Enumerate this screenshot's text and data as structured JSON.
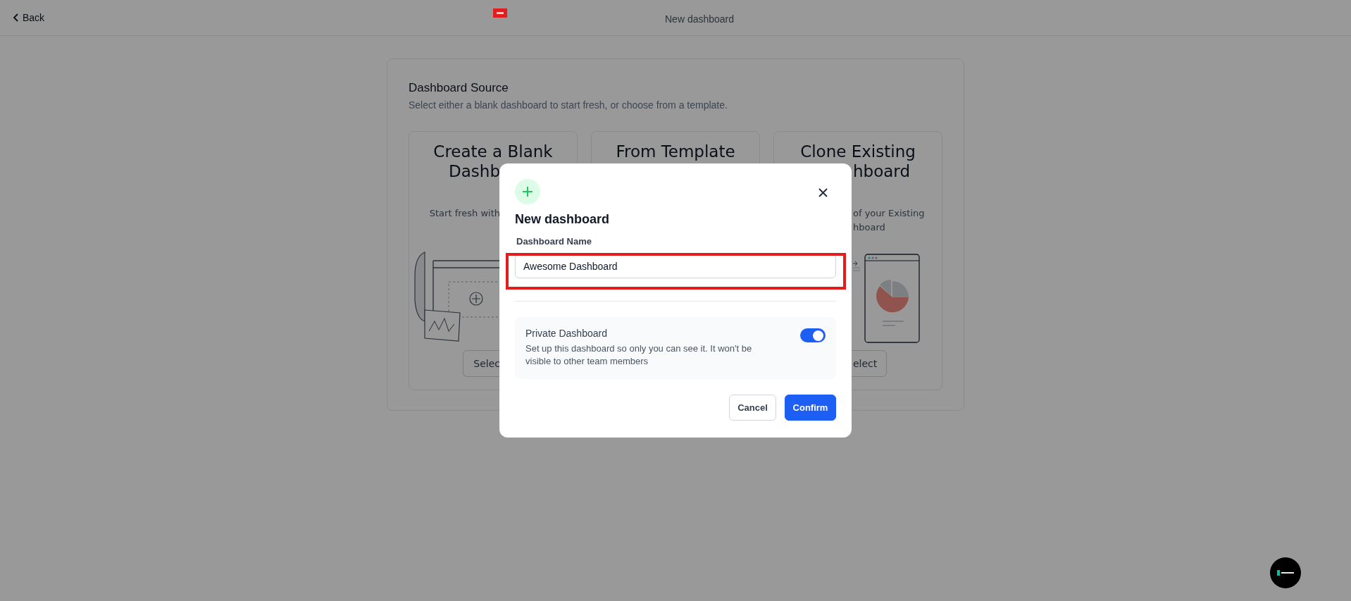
{
  "top_bar": {
    "back": "Back",
    "title": "New dashboard"
  },
  "source": {
    "title": "Dashboard Source",
    "subtitle": "Select either a blank dashboard to start fresh, or choose from a template.",
    "cards": [
      {
        "kind": "blank",
        "title_lines": [
          "Create a Blank",
          "Dashb"
        ],
        "description_lines": [
          "Start fresh with"
        ],
        "button": "Selec"
      },
      {
        "kind": "template",
        "title_lines": [
          "From Template"
        ]
      },
      {
        "kind": "clone",
        "title_lines": [
          "Clone Existing",
          "hboard"
        ],
        "description_lines": [
          "of your Existing",
          "hboard"
        ],
        "button": "elect"
      }
    ]
  },
  "modal": {
    "title": "New dashboard",
    "field_label": "Dashboard Name",
    "field_value": "Awesome Dashboard",
    "private": {
      "title": "Private Dashboard",
      "description": "Set up this dashboard so only you can see it. It won't be visible to other team members",
      "on": true
    },
    "buttons": [
      {
        "label": "Cancel",
        "kind": "secondary"
      },
      {
        "label": "Confirm",
        "kind": "primary"
      }
    ]
  }
}
